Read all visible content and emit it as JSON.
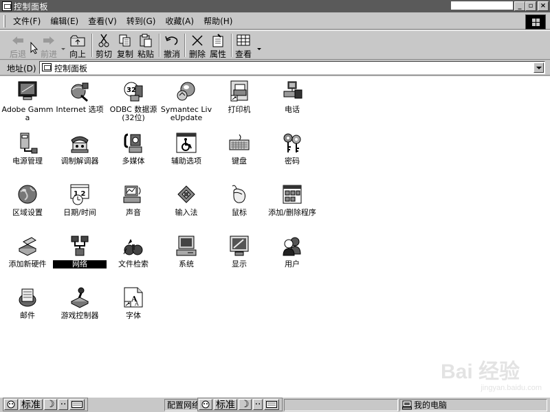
{
  "window": {
    "title": "控制面板"
  },
  "menu": [
    "文件(F)",
    "编辑(E)",
    "查看(V)",
    "转到(G)",
    "收藏(A)",
    "帮助(H)"
  ],
  "toolbar": {
    "back": "后退",
    "forward": "前进",
    "up": "向上",
    "cut": "剪切",
    "copy": "复制",
    "paste": "粘贴",
    "undo": "撤消",
    "delete": "删除",
    "properties": "属性",
    "views": "查看"
  },
  "address": {
    "label": "地址(D)",
    "value": "控制面板"
  },
  "items": [
    {
      "label": "Adobe Gamma",
      "icon": "monitor-icon"
    },
    {
      "label": "Internet 选项",
      "icon": "internet-icon"
    },
    {
      "label": "ODBC 数据源 (32位)",
      "icon": "odbc-icon"
    },
    {
      "label": "Symantec LiveUpdate",
      "icon": "globe-update-icon"
    },
    {
      "label": "打印机",
      "icon": "printer-icon"
    },
    {
      "label": "电话",
      "icon": "telephone-icon"
    },
    {
      "label": "电源管理",
      "icon": "power-icon"
    },
    {
      "label": "调制解调器",
      "icon": "modem-icon"
    },
    {
      "label": "多媒体",
      "icon": "multimedia-icon"
    },
    {
      "label": "辅助选项",
      "icon": "accessibility-icon"
    },
    {
      "label": "键盘",
      "icon": "keyboard-icon"
    },
    {
      "label": "密码",
      "icon": "keys-icon"
    },
    {
      "label": "区域设置",
      "icon": "globe-icon"
    },
    {
      "label": "日期/时间",
      "icon": "calendar-clock-icon"
    },
    {
      "label": "声音",
      "icon": "speaker-icon"
    },
    {
      "label": "输入法",
      "icon": "input-method-icon"
    },
    {
      "label": "鼠标",
      "icon": "mouse-icon"
    },
    {
      "label": "添加/删除程序",
      "icon": "add-remove-icon"
    },
    {
      "label": "添加新硬件",
      "icon": "hardware-icon"
    },
    {
      "label": "网络",
      "icon": "network-icon"
    },
    {
      "label": "文件检索",
      "icon": "binoculars-icon"
    },
    {
      "label": "系统",
      "icon": "computer-icon"
    },
    {
      "label": "显示",
      "icon": "display-icon"
    },
    {
      "label": "用户",
      "icon": "users-icon"
    },
    {
      "label": "邮件",
      "icon": "mail-icon"
    },
    {
      "label": "游戏控制器",
      "icon": "joystick-icon"
    },
    {
      "label": "字体",
      "icon": "fonts-icon"
    }
  ],
  "statusbar": {
    "ime_label": "标准",
    "config_text": "配置网络",
    "location": "我的电脑"
  },
  "watermark": {
    "text": "Bai 经验",
    "url": "jingyan.baidu.com"
  }
}
